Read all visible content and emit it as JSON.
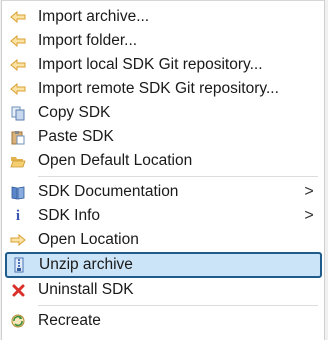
{
  "menu": {
    "items": [
      {
        "label": "Import archive...",
        "icon": "import-arrow-icon"
      },
      {
        "label": "Import folder...",
        "icon": "import-arrow-icon"
      },
      {
        "label": "Import local SDK Git repository...",
        "icon": "import-arrow-icon"
      },
      {
        "label": "Import remote SDK Git repository...",
        "icon": "import-arrow-icon"
      },
      {
        "label": "Copy SDK",
        "icon": "copy-icon"
      },
      {
        "label": "Paste SDK",
        "icon": "paste-icon"
      },
      {
        "label": "Open Default Location",
        "icon": "folder-open-icon"
      },
      {
        "label": "SDK Documentation",
        "icon": "book-icon",
        "submenu": ">"
      },
      {
        "label": "SDK Info",
        "icon": "info-icon",
        "submenu": ">"
      },
      {
        "label": "Open Location",
        "icon": "open-arrow-icon"
      },
      {
        "label": "Unzip archive",
        "icon": "unzip-icon"
      },
      {
        "label": "Uninstall SDK",
        "icon": "delete-icon"
      },
      {
        "label": "Recreate",
        "icon": "recreate-icon"
      }
    ]
  },
  "colors": {
    "highlight_bg": "#cce4f7",
    "highlight_border": "#1f5c8c",
    "arrow": "#e8b34a",
    "delete": "#d9302c",
    "info": "#3a56b0"
  }
}
